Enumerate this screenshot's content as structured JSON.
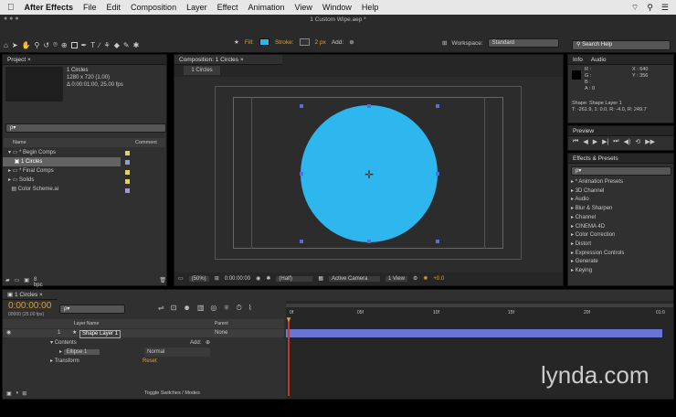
{
  "menubar": {
    "apple": "",
    "app": "After Effects",
    "items": [
      "File",
      "Edit",
      "Composition",
      "Layer",
      "Effect",
      "Animation",
      "View",
      "Window",
      "Help"
    ]
  },
  "window_title": "1 Custom Wipe.aep *",
  "toolbar": {
    "fill_label": "Fill:",
    "stroke_label": "Stroke:",
    "stroke_width": "2 px",
    "add_label": "Add:",
    "workspace_label": "Workspace:",
    "workspace_value": "Standard",
    "search_placeholder": "Search Help",
    "fill_color": "#29b6ef"
  },
  "project": {
    "tab": "Project",
    "selected_name": "1 Circles",
    "selected_info": "1280 x 720 (1.00)",
    "selected_duration": "Δ 0:00:01:00, 25.00 fps",
    "search_placeholder": "ρ▾",
    "col_name": "Name",
    "col_comment": "Comment",
    "items": [
      {
        "name": "Begin Comps",
        "type": "folder"
      },
      {
        "name": "1 Circles",
        "type": "comp"
      },
      {
        "name": "Final Comps",
        "type": "folder"
      },
      {
        "name": "Solids",
        "type": "folder"
      },
      {
        "name": "Color Scheme.ai",
        "type": "file"
      }
    ],
    "bpc": "8 bpc"
  },
  "composition": {
    "tab": "Composition: 1 Circles",
    "subtab": "1 Circles",
    "zoom": "(50%)",
    "timecode": "0:00:00:00",
    "resolution": "(Half)",
    "camera": "Active Camera",
    "views": "1 View",
    "exposure": "+0.0",
    "circle_color": "#2db7ee"
  },
  "info": {
    "tab": "Info",
    "audio_tab": "Audio",
    "r": "R :",
    "g": "G :",
    "b": "B :",
    "a": "A : 0",
    "x": "X : 640",
    "y": "Y : 356",
    "shape": "Shape: Shape Layer 1",
    "transform": "T: -261.9, 1: 0.0, R: -4.0, R: 249.7"
  },
  "preview": {
    "tab": "Preview"
  },
  "effects": {
    "tab": "Effects & Presets",
    "search": "ρ▾",
    "items": [
      "* Animation Presets",
      "3D Channel",
      "Audio",
      "Blur & Sharpen",
      "Channel",
      "CINEMA 4D",
      "Color Correction",
      "Distort",
      "Expression Controls",
      "Generate",
      "Keying"
    ]
  },
  "timeline": {
    "tab": "1 Circles",
    "timecode": "0:00:00:00",
    "frames": "00000 (25.00 fps)",
    "search": "ρ▾",
    "col_layer_name": "Layer Name",
    "col_parent": "Parent",
    "layer_num": "1",
    "layer_name": "Shape Layer 1",
    "parent": "None",
    "contents": "Contents",
    "add": "Add:",
    "ellipse": "Ellipse 1",
    "mode": "Normal",
    "transform": "Transform",
    "reset": "Reset",
    "toggle": "Toggle Switches / Modes",
    "ruler": [
      "0f",
      "05f",
      "10f",
      "15f",
      "20f",
      "01:0"
    ],
    "track_color": "#6874d6"
  },
  "watermark": "lynda.com"
}
